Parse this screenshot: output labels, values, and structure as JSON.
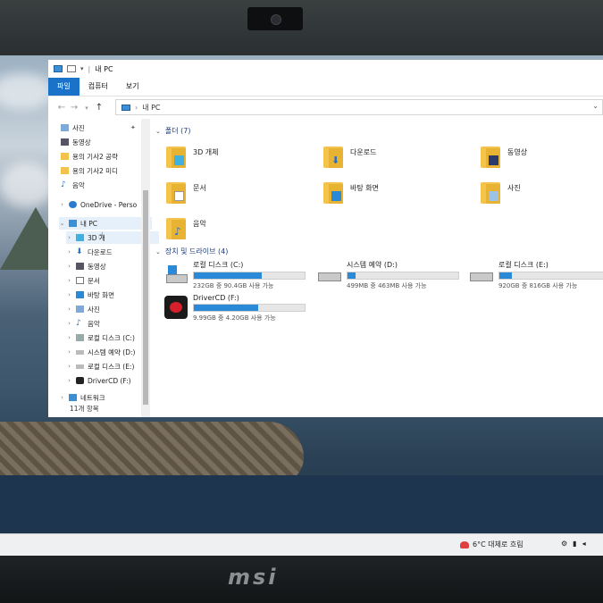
{
  "window": {
    "title": "내 PC",
    "tabs": [
      "파일",
      "컴퓨터",
      "보기"
    ],
    "address": "내 PC"
  },
  "sidebar": {
    "items": [
      {
        "label": "사진",
        "pinned": true
      },
      {
        "label": "동영상"
      },
      {
        "label": "용의 기사2 공략"
      },
      {
        "label": "용의 기사2 미디"
      },
      {
        "label": "음악"
      },
      {
        "label": "OneDrive - Perso"
      },
      {
        "label": "내 PC"
      },
      {
        "label": "3D 개"
      },
      {
        "label": "다운로드"
      },
      {
        "label": "동영상"
      },
      {
        "label": "문서"
      },
      {
        "label": "바탕 화면"
      },
      {
        "label": "사진"
      },
      {
        "label": "음악"
      },
      {
        "label": "로컬 디스크 (C:)"
      },
      {
        "label": "시스템 예약 (D:)"
      },
      {
        "label": "로컬 디스크 (E:)"
      },
      {
        "label": "DriverCD (F:)"
      },
      {
        "label": "네트워크"
      }
    ],
    "status": "11개 항목"
  },
  "content": {
    "folders_header": "폴더 (7)",
    "folders": [
      {
        "name": "3D 개체",
        "icon": "3d-objects-icon"
      },
      {
        "name": "다운로드",
        "icon": "download-icon"
      },
      {
        "name": "동영상",
        "icon": "video-icon"
      },
      {
        "name": "문서",
        "icon": "documents-icon"
      },
      {
        "name": "바탕 화면",
        "icon": "desktop-icon"
      },
      {
        "name": "사진",
        "icon": "pictures-icon"
      },
      {
        "name": "음악",
        "icon": "music-icon"
      }
    ],
    "drives_header": "장치 및 드라이브 (4)",
    "drives": [
      {
        "name": "로컬 디스크 (C:)",
        "space": "232GB 중 90.4GB 사용 가능",
        "used_fraction": 0.61,
        "icon": "windows-drive-icon"
      },
      {
        "name": "시스템 예약 (D:)",
        "space": "499MB 중 463MB 사용 가능",
        "used_fraction": 0.07,
        "icon": "drive-icon"
      },
      {
        "name": "로컬 디스크 (E:)",
        "space": "920GB 중 816GB 사용 가능",
        "used_fraction": 0.11,
        "icon": "drive-icon"
      },
      {
        "name": "DriverCD (F:)",
        "space": "9.99GB 중 4.20GB 사용 가능",
        "used_fraction": 0.58,
        "icon": "drivercd-icon"
      }
    ]
  },
  "taskbar": {
    "weather": "6°C 대체로 흐림"
  },
  "logo": "msi",
  "colors": {
    "accent": "#1a73c8",
    "bar": "#2b8ad8",
    "folder": "#f2c44b"
  }
}
